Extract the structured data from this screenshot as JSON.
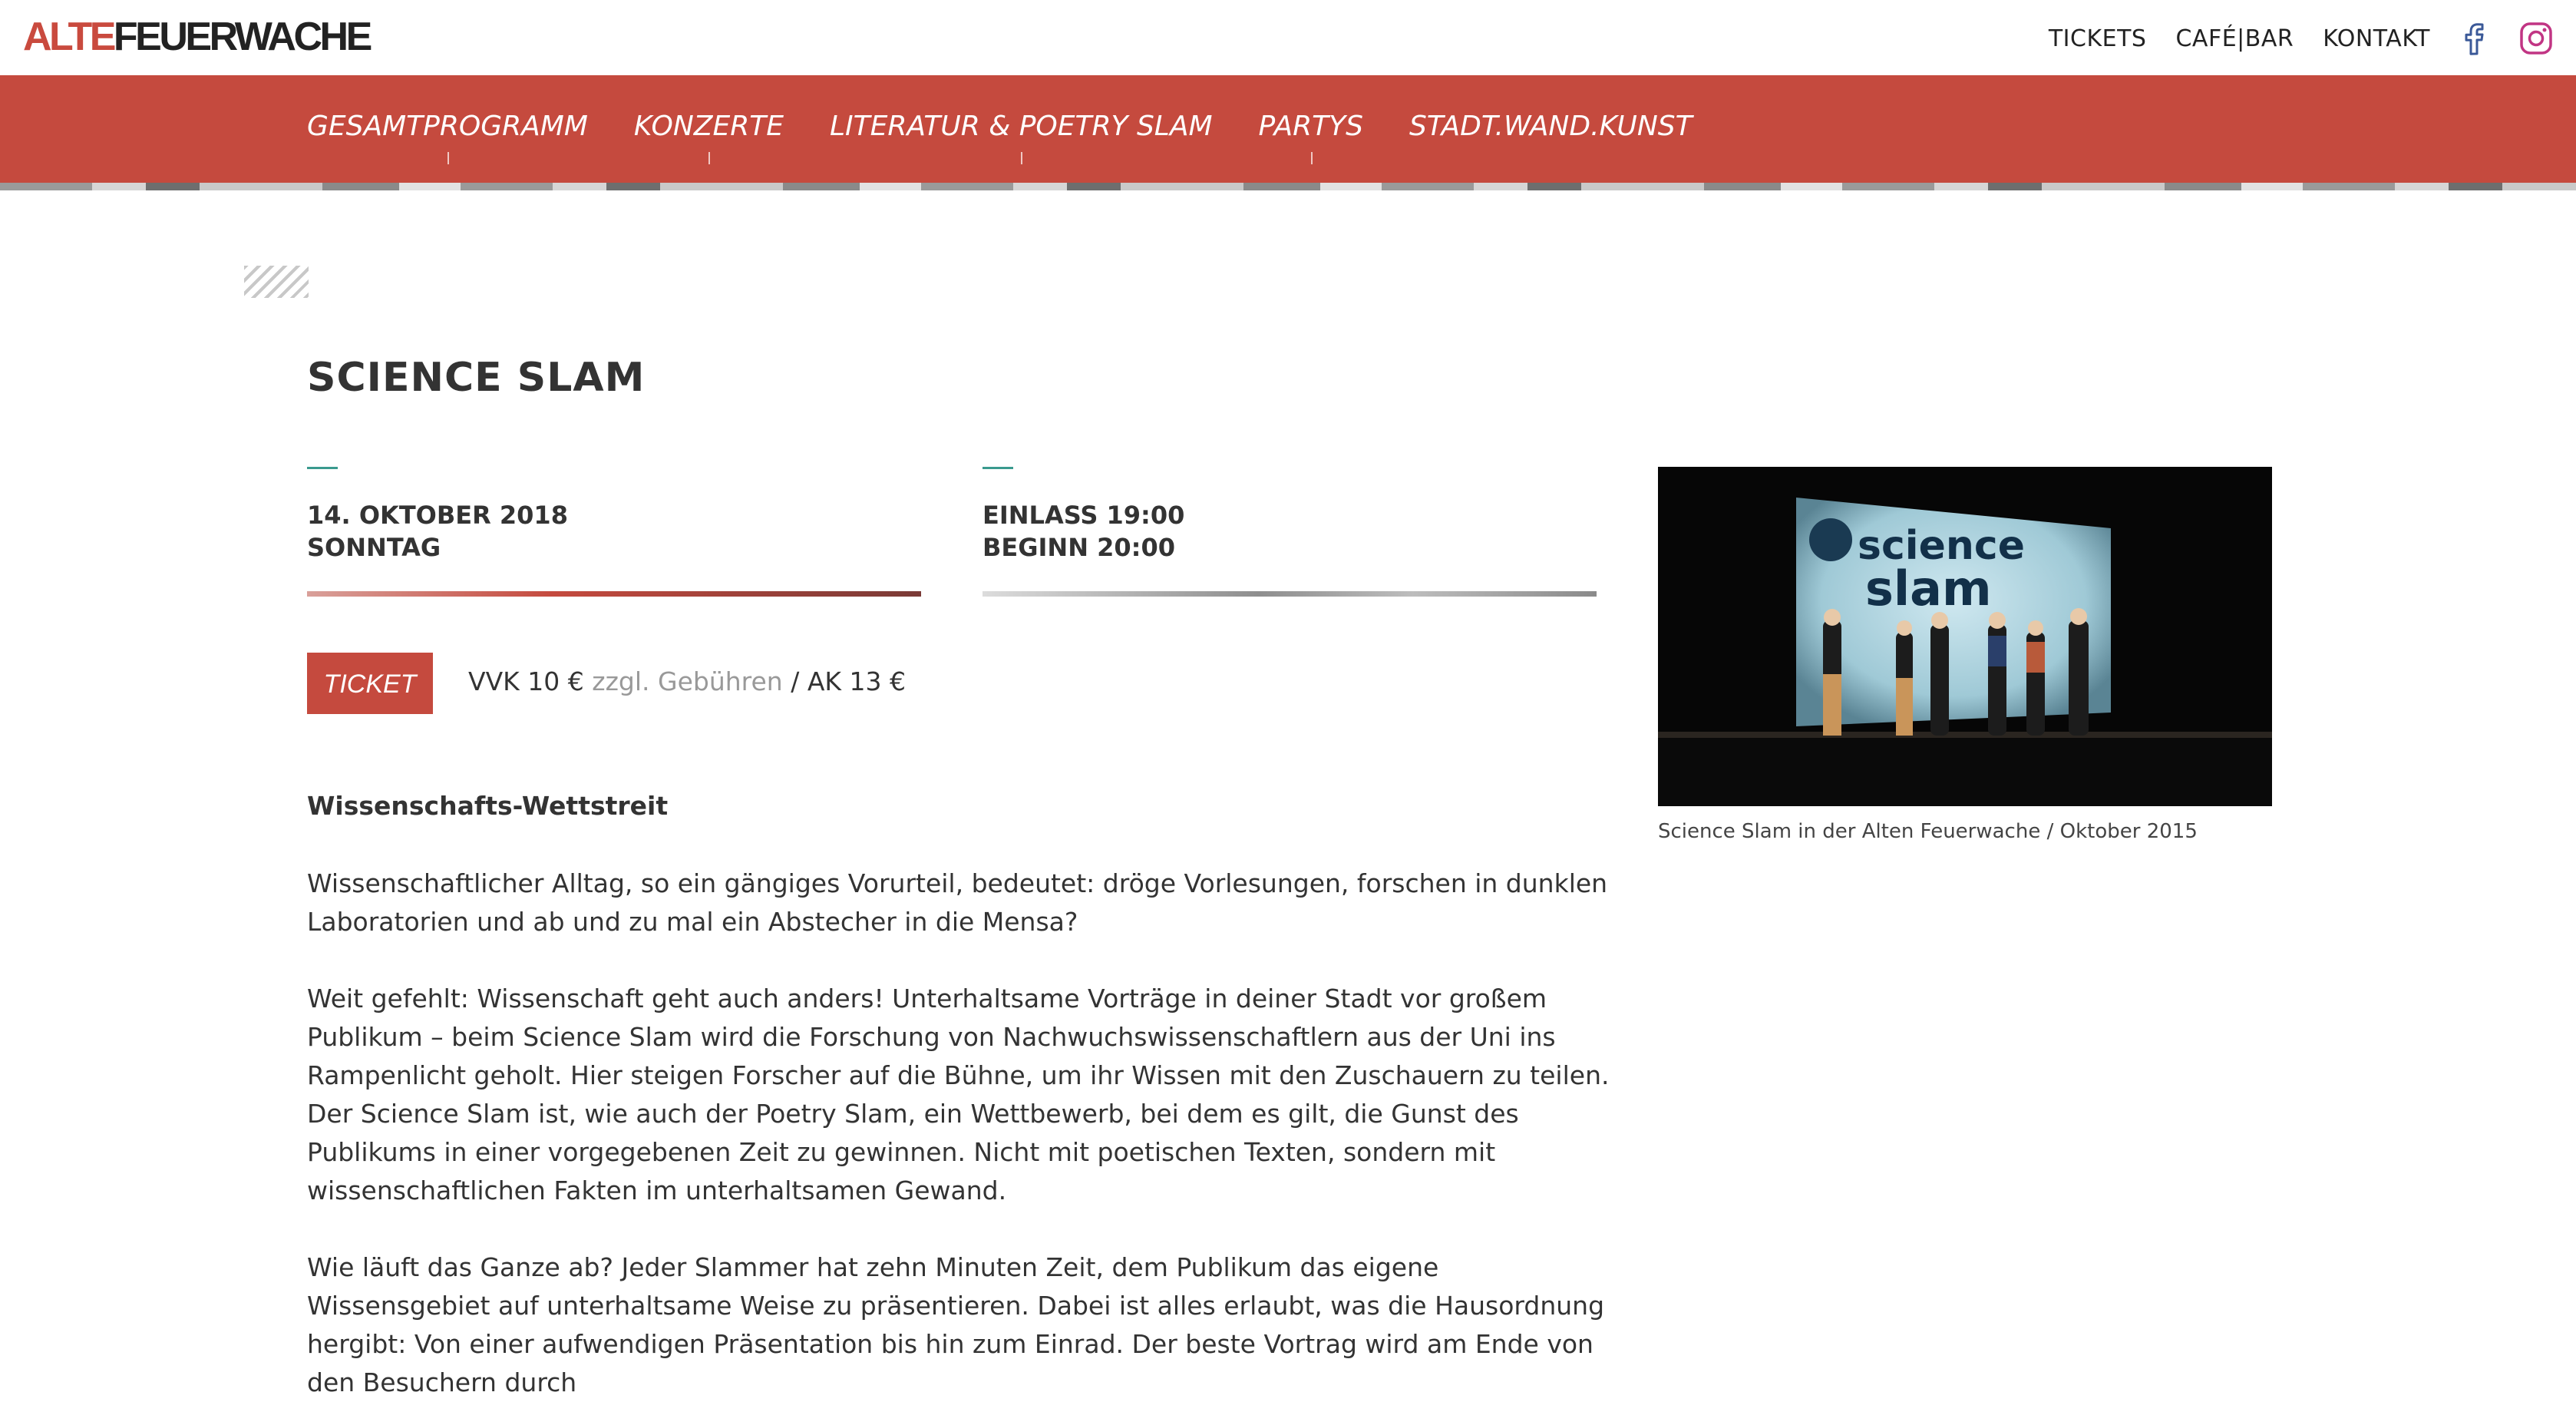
{
  "logo": {
    "part1": "ALTE",
    "part2": "FEUERWACHE"
  },
  "topnav": {
    "tickets": "TICKETS",
    "cafe_bar": "CAFÉ|BAR",
    "kontakt": "KONTAKT",
    "facebook_icon": "facebook-icon",
    "instagram_icon": "instagram-icon"
  },
  "mainnav": [
    {
      "label": "GESAMTPROGRAMM"
    },
    {
      "label": "KONZERTE"
    },
    {
      "label": "LITERATUR & POETRY SLAM"
    },
    {
      "label": "PARTYS"
    },
    {
      "label": "STADT.WAND.KUNST"
    }
  ],
  "colors": {
    "brand_red": "#c54a3e",
    "accent_teal": "#3a9a8e"
  },
  "event": {
    "title": "SCIENCE SLAM",
    "date": "14. OKTOBER 2018",
    "weekday": "SONNTAG",
    "einlass": "EINLASS 19:00",
    "beginn": "BEGINN 20:00",
    "ticket_label": "TICKET",
    "price_vvk": "VVK 10 €",
    "price_fees": "zzgl. Gebühren",
    "price_ak": "/ AK 13 €",
    "subhead": "Wissenschafts-Wettstreit",
    "paragraphs": [
      "Wissenschaftlicher Alltag, so ein gängiges Vorurteil, bedeutet: dröge Vorlesungen, forschen in dunklen Laboratorien und ab und zu mal ein Abstecher in die Mensa?",
      "Weit gefehlt: Wissenschaft geht auch anders! Unterhaltsame Vorträge in deiner Stadt vor großem Publikum – beim Science Slam wird die Forschung von Nachwuchswissenschaftlern aus der Uni ins Rampenlicht geholt. Hier steigen Forscher auf die Bühne, um ihr Wissen mit den Zuschauern zu teilen.",
      "Der Science Slam ist, wie auch der Poetry Slam, ein Wettbewerb, bei dem es  gilt, die Gunst des Publikums in einer vorgegebenen Zeit zu gewinnen. Nicht mit poetischen Texten, sondern mit wissenschaftlichen Fakten im unterhaltsamen Gewand.",
      "Wie läuft das Ganze ab? Jeder Slammer hat zehn Minuten Zeit, dem Publikum das eigene Wissensgebiet auf unterhaltsame Weise zu präsentieren. Dabei ist alles erlaubt, was die Hausordnung hergibt: Von einer aufwendigen Präsentation bis hin zum Einrad. Der beste Vortrag wird am Ende von den Besuchern durch"
    ],
    "image_caption": "Science Slam in der Alten Feuerwache / Oktober 2015",
    "screen_text_1": "science",
    "screen_text_2": "slam"
  }
}
